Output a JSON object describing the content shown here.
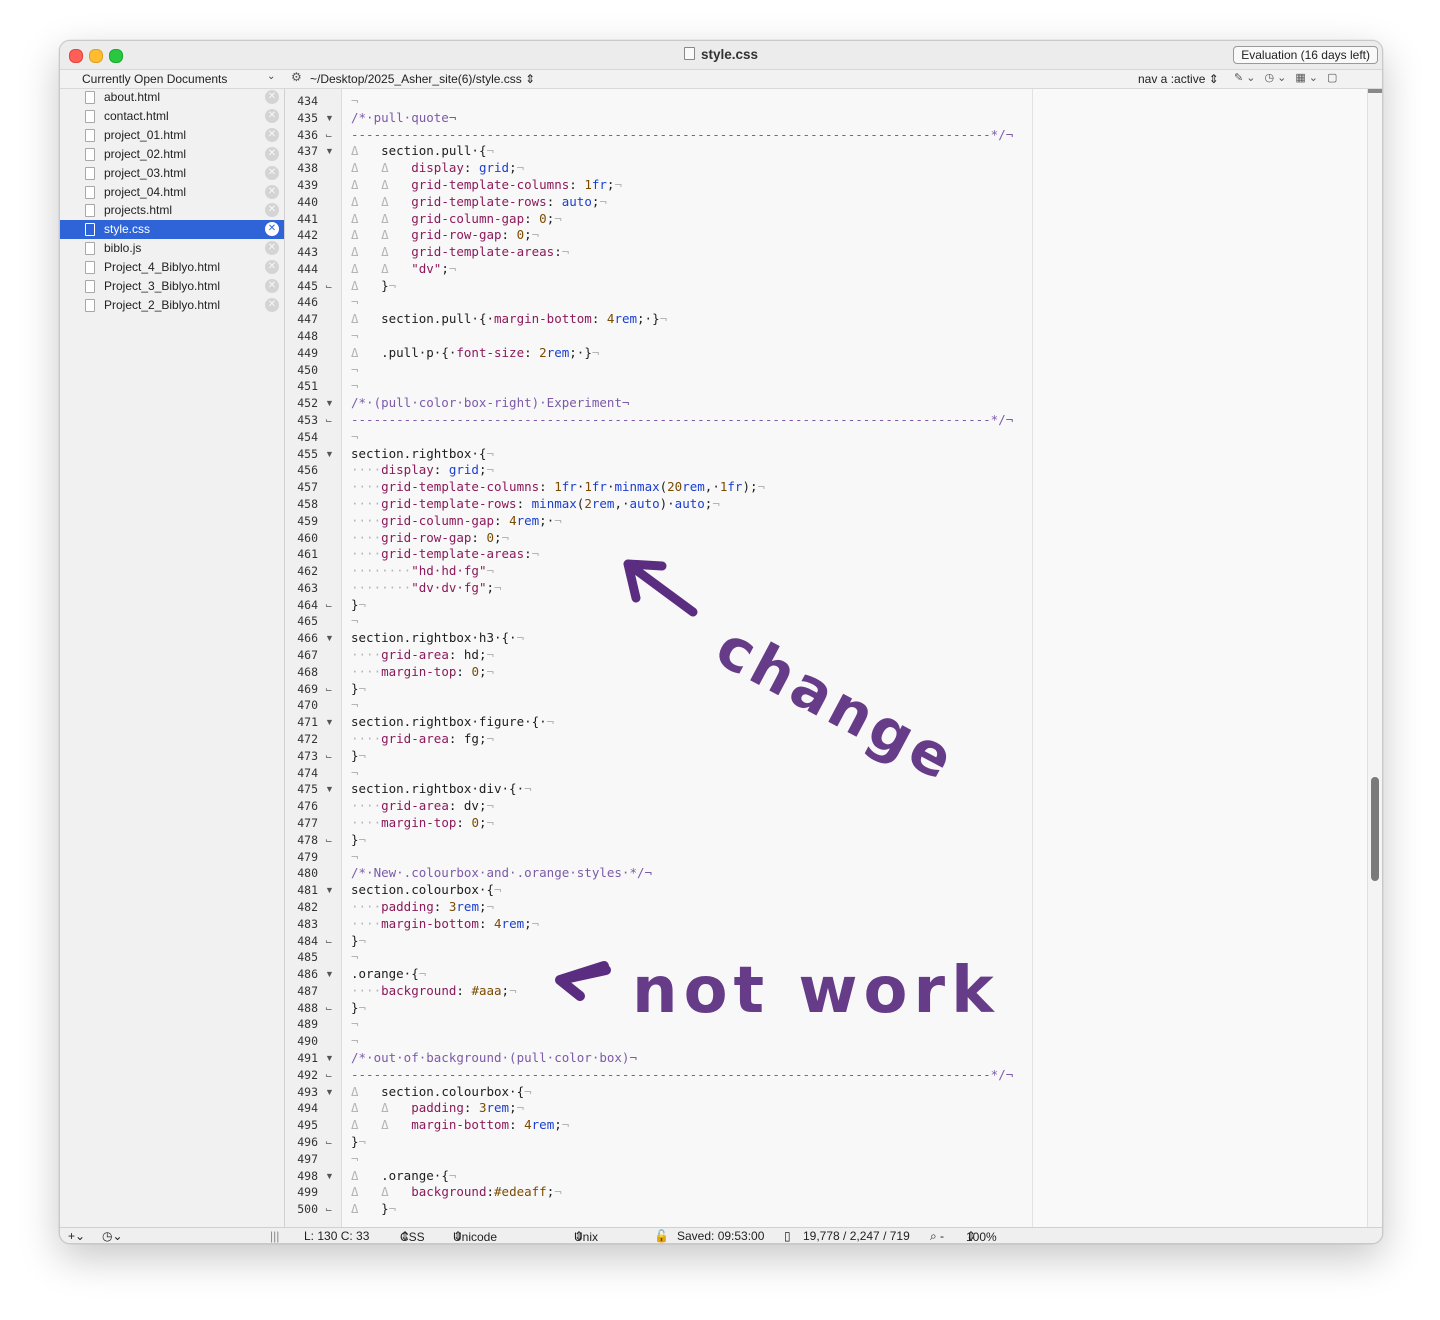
{
  "window": {
    "title": "style.css",
    "evaluation_label": "Evaluation (16 days left)"
  },
  "navbar": {
    "documents_label": "Currently Open Documents",
    "path": "~/Desktop/2025_Asher_site(6)/style.css",
    "selector": "nav a :active"
  },
  "sidebar": {
    "files": [
      {
        "name": "about.html",
        "active": false
      },
      {
        "name": "contact.html",
        "active": false
      },
      {
        "name": "project_01.html",
        "active": false
      },
      {
        "name": "project_02.html",
        "active": false
      },
      {
        "name": "project_03.html",
        "active": false
      },
      {
        "name": "project_04.html",
        "active": false
      },
      {
        "name": "projects.html",
        "active": false
      },
      {
        "name": "style.css",
        "active": true
      },
      {
        "name": "biblo.js",
        "active": false
      },
      {
        "name": "Project_4_Biblyo.html",
        "active": false
      },
      {
        "name": "Project_3_Biblyo.html",
        "active": false
      },
      {
        "name": "Project_2_Biblyo.html",
        "active": false
      }
    ]
  },
  "code": {
    "lines": [
      {
        "n": "434",
        "fold": "",
        "html": "<span class='invis'>¬</span>"
      },
      {
        "n": "435",
        "fold": "▼",
        "html": "<span class='cm'>/*·pull·quote¬</span>"
      },
      {
        "n": "436",
        "fold": "⌙",
        "html": "<span class='cm'>-------------------------------------------------------------------------------------*/¬</span>"
      },
      {
        "n": "437",
        "fold": "▼",
        "html": "<span class='invis'>Δ</span>   section.pull·{<span class='invis'>¬</span>"
      },
      {
        "n": "438",
        "fold": "",
        "html": "<span class='invis'>Δ</span>   <span class='invis'>Δ</span>   <span class='kw'>display</span>: <span class='unit'>grid</span>;<span class='invis'>¬</span>"
      },
      {
        "n": "439",
        "fold": "",
        "html": "<span class='invis'>Δ</span>   <span class='invis'>Δ</span>   <span class='kw'>grid-template-columns</span>: <span class='num'>1</span><span class='unit'>fr</span>;<span class='invis'>¬</span>"
      },
      {
        "n": "440",
        "fold": "",
        "html": "<span class='invis'>Δ</span>   <span class='invis'>Δ</span>   <span class='kw'>grid-template-rows</span>: <span class='unit'>auto</span>;<span class='invis'>¬</span>"
      },
      {
        "n": "441",
        "fold": "",
        "html": "<span class='invis'>Δ</span>   <span class='invis'>Δ</span>   <span class='kw'>grid-column-gap</span>: <span class='num'>0</span>;<span class='invis'>¬</span>"
      },
      {
        "n": "442",
        "fold": "",
        "html": "<span class='invis'>Δ</span>   <span class='invis'>Δ</span>   <span class='kw'>grid-row-gap</span>: <span class='num'>0</span>;<span class='invis'>¬</span>"
      },
      {
        "n": "443",
        "fold": "",
        "html": "<span class='invis'>Δ</span>   <span class='invis'>Δ</span>   <span class='kw'>grid-template-areas</span>:<span class='invis'>¬</span>"
      },
      {
        "n": "444",
        "fold": "",
        "html": "<span class='invis'>Δ</span>   <span class='invis'>Δ</span>   <span class='str'>\"dv\"</span>;<span class='invis'>¬</span>"
      },
      {
        "n": "445",
        "fold": "⌙",
        "html": "<span class='invis'>Δ</span>   }<span class='invis'>¬</span>"
      },
      {
        "n": "446",
        "fold": "",
        "html": "<span class='invis'>¬</span>"
      },
      {
        "n": "447",
        "fold": "",
        "html": "<span class='invis'>Δ</span>   section.pull·{·<span class='kw'>margin-bottom</span>: <span class='num'>4</span><span class='unit'>rem</span>;·}<span class='invis'>¬</span>"
      },
      {
        "n": "448",
        "fold": "",
        "html": "<span class='invis'>¬</span>"
      },
      {
        "n": "449",
        "fold": "",
        "html": "<span class='invis'>Δ</span>   .pull·p·{·<span class='kw'>font-size</span>: <span class='num'>2</span><span class='unit'>rem</span>;·}<span class='invis'>¬</span>"
      },
      {
        "n": "450",
        "fold": "",
        "html": "<span class='invis'>¬</span>"
      },
      {
        "n": "451",
        "fold": "",
        "html": "<span class='invis'>¬</span>"
      },
      {
        "n": "452",
        "fold": "▼",
        "html": "<span class='cm'>/*·(pull·color·box-right)·Experiment¬</span>"
      },
      {
        "n": "453",
        "fold": "⌙",
        "html": "<span class='cm'>-------------------------------------------------------------------------------------*/¬</span>"
      },
      {
        "n": "454",
        "fold": "",
        "html": "<span class='invis'>¬</span>"
      },
      {
        "n": "455",
        "fold": "▼",
        "html": "section.rightbox·{<span class='invis'>¬</span>"
      },
      {
        "n": "456",
        "fold": "",
        "html": "<span class='invis'>····</span><span class='kw'>display</span>: <span class='unit'>grid</span>;<span class='invis'>¬</span>"
      },
      {
        "n": "457",
        "fold": "",
        "html": "<span class='invis'>····</span><span class='kw'>grid-template-columns</span>: <span class='num'>1</span><span class='unit'>fr</span>·<span class='num'>1</span><span class='unit'>fr</span>·<span class='unit'>minmax</span>(<span class='num'>20</span><span class='unit'>rem</span>,·<span class='num'>1</span><span class='unit'>fr</span>);<span class='invis'>¬</span>"
      },
      {
        "n": "458",
        "fold": "",
        "html": "<span class='invis'>····</span><span class='kw'>grid-template-rows</span>: <span class='unit'>minmax</span>(<span class='num'>2</span><span class='unit'>rem</span>,·<span class='unit'>auto</span>)·<span class='unit'>auto</span>;<span class='invis'>¬</span>"
      },
      {
        "n": "459",
        "fold": "",
        "html": "<span class='invis'>····</span><span class='kw'>grid-column-gap</span>: <span class='num'>4</span><span class='unit'>rem</span>;·<span class='invis'>¬</span>"
      },
      {
        "n": "460",
        "fold": "",
        "html": "<span class='invis'>····</span><span class='kw'>grid-row-gap</span>: <span class='num'>0</span>;<span class='invis'>¬</span>"
      },
      {
        "n": "461",
        "fold": "",
        "html": "<span class='invis'>····</span><span class='kw'>grid-template-areas</span>:<span class='invis'>¬</span>"
      },
      {
        "n": "462",
        "fold": "",
        "html": "<span class='invis'>········</span><span class='str'>\"hd·hd·fg\"</span><span class='invis'>¬</span>"
      },
      {
        "n": "463",
        "fold": "",
        "html": "<span class='invis'>········</span><span class='str'>\"dv·dv·fg\"</span>;<span class='invis'>¬</span>"
      },
      {
        "n": "464",
        "fold": "⌙",
        "html": "}<span class='invis'>¬</span>"
      },
      {
        "n": "465",
        "fold": "",
        "html": "<span class='invis'>¬</span>"
      },
      {
        "n": "466",
        "fold": "▼",
        "html": "section.rightbox·h3·{·<span class='invis'>¬</span>"
      },
      {
        "n": "467",
        "fold": "",
        "html": "<span class='invis'>····</span><span class='kw'>grid-area</span>: hd;<span class='invis'>¬</span>"
      },
      {
        "n": "468",
        "fold": "",
        "html": "<span class='invis'>····</span><span class='kw'>margin-top</span>: <span class='num'>0</span>;<span class='invis'>¬</span>"
      },
      {
        "n": "469",
        "fold": "⌙",
        "html": "}<span class='invis'>¬</span>"
      },
      {
        "n": "470",
        "fold": "",
        "html": "<span class='invis'>¬</span>"
      },
      {
        "n": "471",
        "fold": "▼",
        "html": "section.rightbox·figure·{·<span class='invis'>¬</span>"
      },
      {
        "n": "472",
        "fold": "",
        "html": "<span class='invis'>····</span><span class='kw'>grid-area</span>: fg;<span class='invis'>¬</span>"
      },
      {
        "n": "473",
        "fold": "⌙",
        "html": "}<span class='invis'>¬</span>"
      },
      {
        "n": "474",
        "fold": "",
        "html": "<span class='invis'>¬</span>"
      },
      {
        "n": "475",
        "fold": "▼",
        "html": "section.rightbox·div·{·<span class='invis'>¬</span>"
      },
      {
        "n": "476",
        "fold": "",
        "html": "<span class='invis'>····</span><span class='kw'>grid-area</span>: dv;<span class='invis'>¬</span>"
      },
      {
        "n": "477",
        "fold": "",
        "html": "<span class='invis'>····</span><span class='kw'>margin-top</span>: <span class='num'>0</span>;<span class='invis'>¬</span>"
      },
      {
        "n": "478",
        "fold": "⌙",
        "html": "}<span class='invis'>¬</span>"
      },
      {
        "n": "479",
        "fold": "",
        "html": "<span class='invis'>¬</span>"
      },
      {
        "n": "480",
        "fold": "",
        "html": "<span class='cm'>/*·New·.colourbox·and·.orange·styles·*/¬</span>"
      },
      {
        "n": "481",
        "fold": "▼",
        "html": "section.colourbox·{<span class='invis'>¬</span>"
      },
      {
        "n": "482",
        "fold": "",
        "html": "<span class='invis'>····</span><span class='kw'>padding</span>: <span class='num'>3</span><span class='unit'>rem</span>;<span class='invis'>¬</span>"
      },
      {
        "n": "483",
        "fold": "",
        "html": "<span class='invis'>····</span><span class='kw'>margin-bottom</span>: <span class='num'>4</span><span class='unit'>rem</span>;<span class='invis'>¬</span>"
      },
      {
        "n": "484",
        "fold": "⌙",
        "html": "}<span class='invis'>¬</span>"
      },
      {
        "n": "485",
        "fold": "",
        "html": "<span class='invis'>¬</span>"
      },
      {
        "n": "486",
        "fold": "▼",
        "html": ".orange·{<span class='invis'>¬</span>"
      },
      {
        "n": "487",
        "fold": "",
        "html": "<span class='invis'>····</span><span class='kw'>background</span>: <span class='hexv'>#aaa</span>;<span class='invis'>¬</span>"
      },
      {
        "n": "488",
        "fold": "⌙",
        "html": "}<span class='invis'>¬</span>"
      },
      {
        "n": "489",
        "fold": "",
        "html": "<span class='invis'>¬</span>"
      },
      {
        "n": "490",
        "fold": "",
        "html": "<span class='invis'>¬</span>"
      },
      {
        "n": "491",
        "fold": "▼",
        "html": "<span class='cm'>/*·out·of·background·(pull·color·box)¬</span>"
      },
      {
        "n": "492",
        "fold": "⌙",
        "html": "<span class='cm'>-------------------------------------------------------------------------------------*/¬</span>"
      },
      {
        "n": "493",
        "fold": "▼",
        "html": "<span class='invis'>Δ</span>   section.colourbox·{<span class='invis'>¬</span>"
      },
      {
        "n": "494",
        "fold": "",
        "html": "<span class='invis'>Δ</span>   <span class='invis'>Δ</span>   <span class='kw'>padding</span>: <span class='num'>3</span><span class='unit'>rem</span>;<span class='invis'>¬</span>"
      },
      {
        "n": "495",
        "fold": "",
        "html": "<span class='invis'>Δ</span>   <span class='invis'>Δ</span>   <span class='kw'>margin-bottom</span>: <span class='num'>4</span><span class='unit'>rem</span>;<span class='invis'>¬</span>"
      },
      {
        "n": "496",
        "fold": "⌙",
        "html": "}<span class='invis'>¬</span>"
      },
      {
        "n": "497",
        "fold": "",
        "html": "<span class='invis'>¬</span>"
      },
      {
        "n": "498",
        "fold": "▼",
        "html": "<span class='invis'>Δ</span>   .orange·{<span class='invis'>¬</span>"
      },
      {
        "n": "499",
        "fold": "",
        "html": "<span class='invis'>Δ</span>   <span class='invis'>Δ</span>   <span class='kw'>background</span>:<span class='hexv'>#edeaff</span>;<span class='invis'>¬</span>"
      },
      {
        "n": "500",
        "fold": "⌙",
        "html": "<span class='invis'>Δ</span>   }<span class='invis'>¬</span>"
      }
    ]
  },
  "annotations": {
    "change": "change",
    "not_work": "not work",
    "color": "#5a2d80"
  },
  "status": {
    "position": "L: 130 C: 33",
    "language": "CSS",
    "encoding": "Unicode (UTF-8)",
    "line_endings": "Unix (LF)",
    "saved": "Saved: 09:53:00",
    "stats": "19,778 / 2,247 / 719",
    "zoom": "100%"
  }
}
